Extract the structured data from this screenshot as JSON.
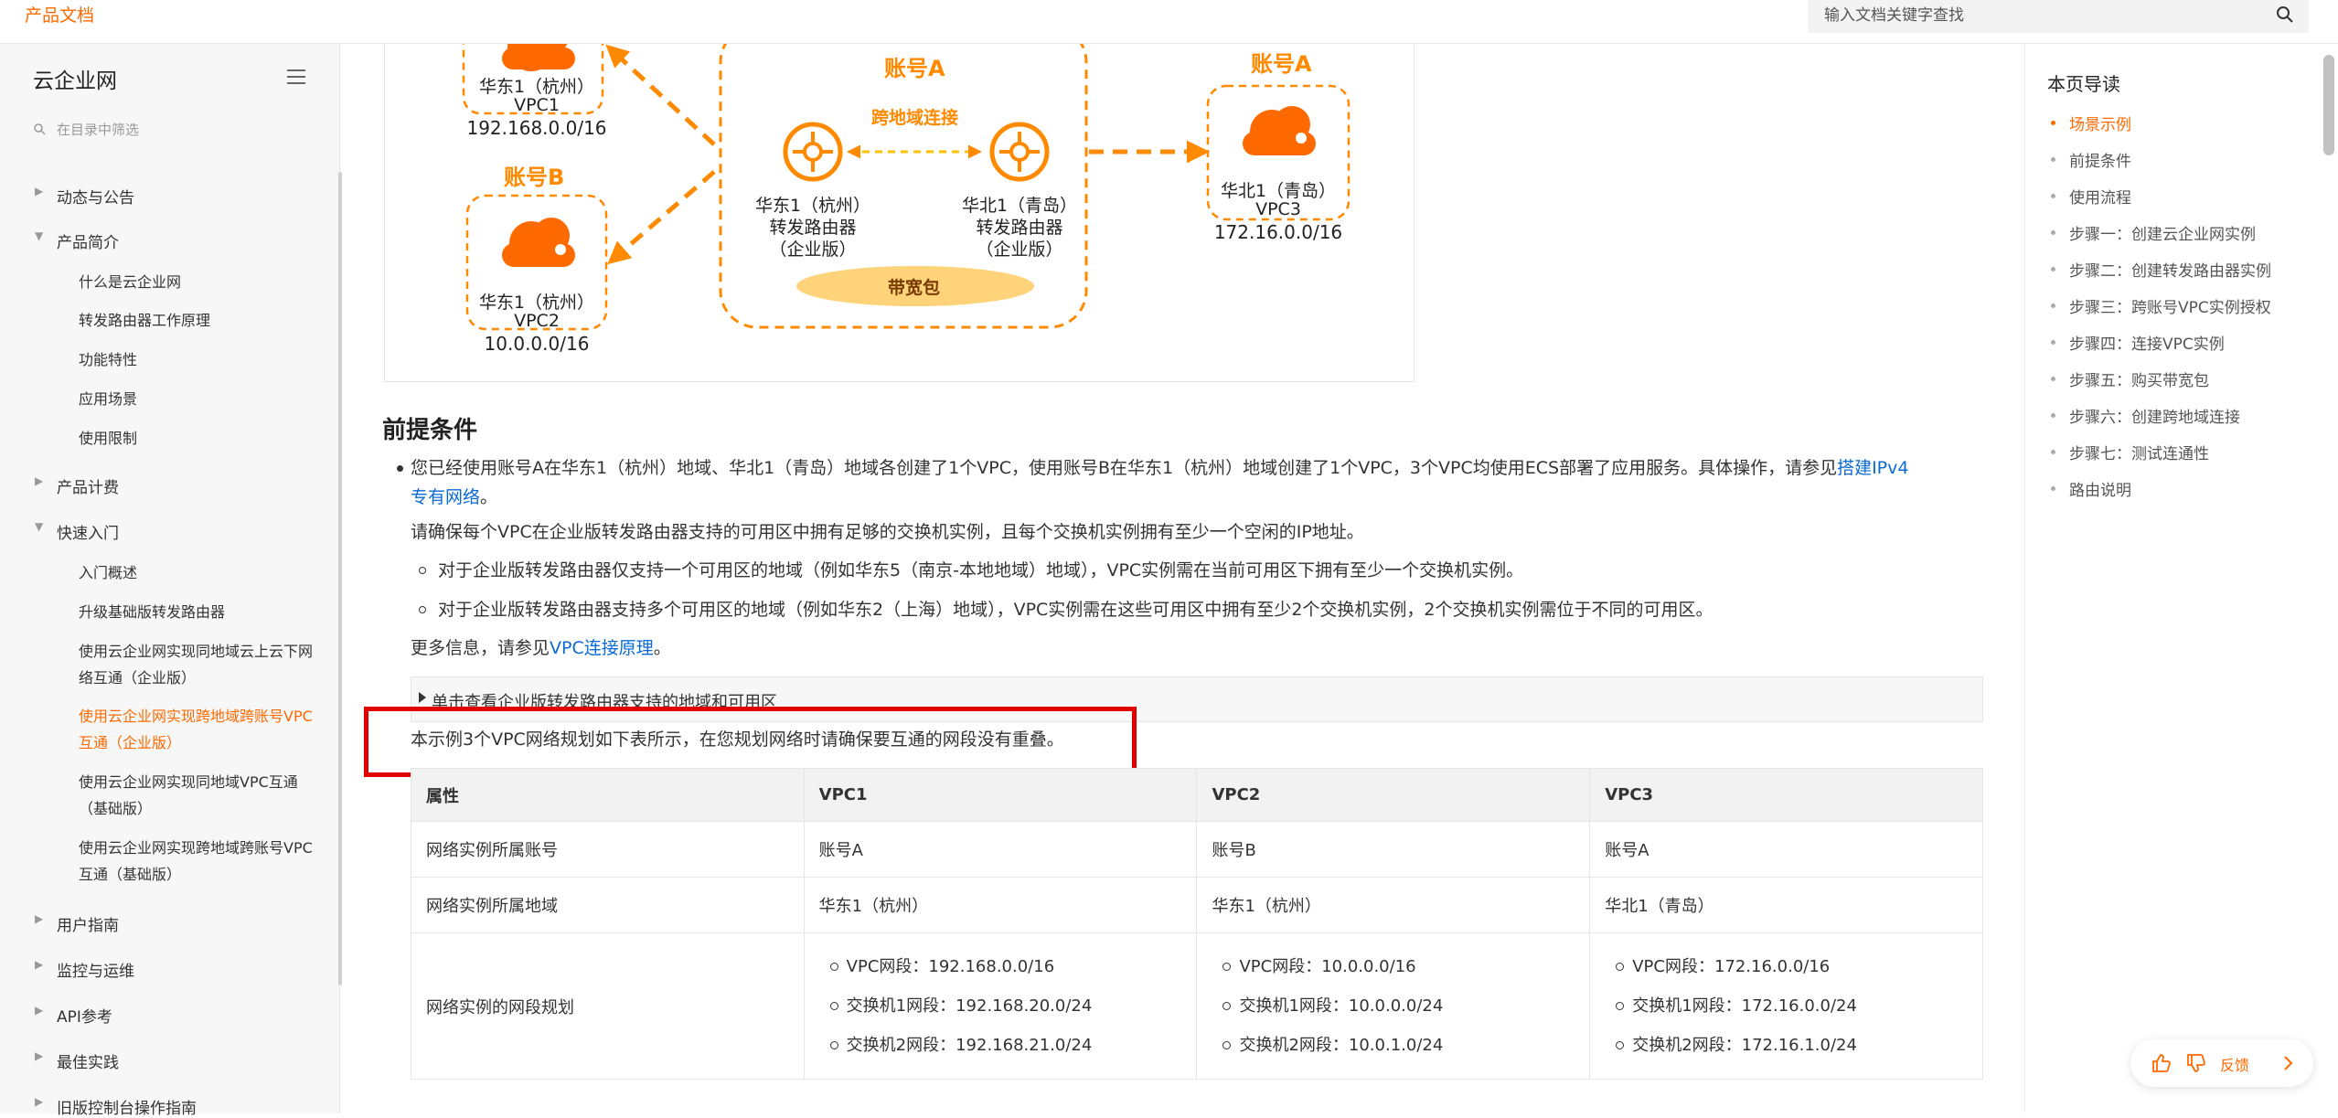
{
  "header": {
    "brand": "产品文档",
    "search_placeholder": "输入文档关键字查找"
  },
  "sidebar": {
    "title": "云企业网",
    "filter_placeholder": "在目录中筛选",
    "items": [
      {
        "label": "动态与公告"
      },
      {
        "label": "产品简介"
      },
      {
        "label": "产品计费"
      },
      {
        "label": "快速入门"
      },
      {
        "label": "用户指南"
      },
      {
        "label": "监控与运维"
      },
      {
        "label": "API参考"
      },
      {
        "label": "最佳实践"
      },
      {
        "label": "旧版控制台操作指南"
      }
    ],
    "intro_sub": [
      "什么是云企业网",
      "转发路由器工作原理",
      "功能特性",
      "应用场景",
      "使用限制"
    ],
    "quick_sub": [
      "入门概述",
      "升级基础版转发路由器",
      "使用云企业网实现同地域云上云下网络互通（企业版）",
      "使用云企业网实现跨地域跨账号VPC互通（企业版）",
      "使用云企业网实现同地域VPC互通（基础版）",
      "使用云企业网实现跨地域跨账号VPC互通（基础版）"
    ]
  },
  "diagram": {
    "acct_a_top": "账号A",
    "acct_a_right": "账号A",
    "acct_b": "账号B",
    "cross_link": "跨地域连接",
    "bandwidth": "带宽包",
    "vpc1_region": "华东1（杭州）",
    "vpc1_name": "VPC1",
    "vpc1_cidr": "192.168.0.0/16",
    "vpc2_region": "华东1（杭州）",
    "vpc2_name": "VPC2",
    "vpc2_cidr": "10.0.0.0/16",
    "vpc3_region": "华北1（青岛）",
    "vpc3_name": "VPC3",
    "vpc3_cidr": "172.16.0.0/16",
    "tr1_region": "华东1（杭州）",
    "tr1_name": "转发路由器",
    "tr1_edition": "（企业版）",
    "tr2_region": "华北1（青岛）",
    "tr2_name": "转发路由器",
    "tr2_edition": "（企业版）"
  },
  "content": {
    "section_title": "前提条件",
    "p1_text": "您已经使用账号A在华东1（杭州）地域、华北1（青岛）地域各创建了1个VPC，使用账号B在华东1（杭州）地域创建了1个VPC，3个VPC均使用ECS部署了应用服务。具体操作，请参见",
    "p1_link_a": "搭建IPv4",
    "p1_link_b": "专有网络",
    "p1_end": "。",
    "p2": "请确保每个VPC在企业版转发路由器支持的可用区中拥有足够的交换机实例，且每个交换机实例拥有至少一个空闲的IP地址。",
    "sub1": "对于企业版转发路由器仅支持一个可用区的地域（例如华东5（南京-本地地域）地域），VPC实例需在当前可用区下拥有至少一个交换机实例。",
    "sub2": "对于企业版转发路由器支持多个可用区的地域（例如华东2（上海）地域），VPC实例需在这些可用区中拥有至少2个交换机实例，2个交换机实例需位于不同的可用区。",
    "more_prefix": "更多信息，请参见",
    "more_link": "VPC连接原理",
    "more_end": "。",
    "details_summary": "单击查看企业版转发路由器支持的地域和可用区",
    "plan_note": "本示例3个VPC网络规划如下表所示，在您规划网络时请确保要互通的网段没有重叠。"
  },
  "table": {
    "headers": [
      "属性",
      "VPC1",
      "VPC2",
      "VPC3"
    ],
    "row1": [
      "网络实例所属账号",
      "账号A",
      "账号B",
      "账号A"
    ],
    "row2": [
      "网络实例所属地域",
      "华东1（杭州）",
      "华东1（杭州）",
      "华北1（青岛）"
    ],
    "row3_label": "网络实例的网段规划",
    "row3_vpc1": [
      "VPC网段：192.168.0.0/16",
      "交换机1网段：192.168.20.0/24",
      "交换机2网段：192.168.21.0/24"
    ],
    "row3_vpc2": [
      "VPC网段：10.0.0.0/16",
      "交换机1网段：10.0.0.0/24",
      "交换机2网段：10.0.1.0/24"
    ],
    "row3_vpc3": [
      "VPC网段：172.16.0.0/16",
      "交换机1网段：172.16.0.0/24",
      "交换机2网段：172.16.1.0/24"
    ]
  },
  "toc": {
    "title": "本页导读",
    "items": [
      "场景示例",
      "前提条件",
      "使用流程",
      "步骤一：创建云企业网实例",
      "步骤二：创建转发路由器实例",
      "步骤三：跨账号VPC实例授权",
      "步骤四：连接VPC实例",
      "步骤五：购买带宽包",
      "步骤六：创建跨地域连接",
      "步骤七：测试连通性",
      "路由说明"
    ]
  },
  "feedback": {
    "label": "反馈"
  },
  "colors": {
    "accent": "#ff6a00",
    "link": "#0a6ad6",
    "highlight": "#e00000"
  }
}
